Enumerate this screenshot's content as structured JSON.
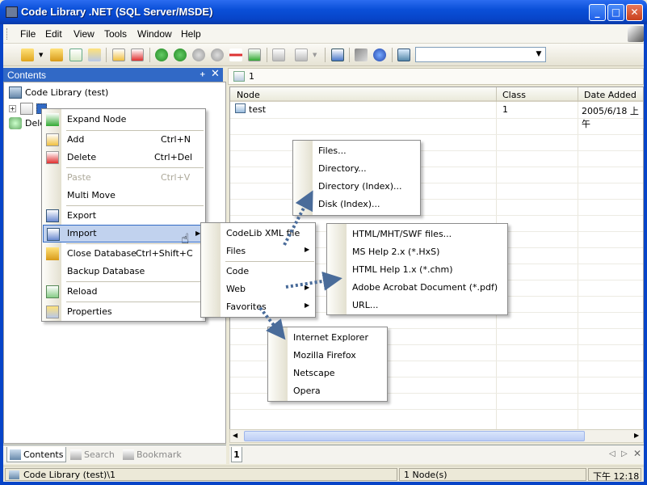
{
  "window": {
    "title": "Code Library .NET (SQL Server/MSDE)",
    "min": "_",
    "max": "□",
    "close": "✕"
  },
  "menubar": {
    "items": [
      "File",
      "Edit",
      "View",
      "Tools",
      "Window",
      "Help"
    ]
  },
  "contents_pane": {
    "title": "Contents",
    "pin": "ᚐ",
    "close": "✕"
  },
  "tree": {
    "root": "Code Library (test)",
    "deleted": "Dele"
  },
  "pane_tabs": [
    {
      "label": "Contents"
    },
    {
      "label": "Search"
    },
    {
      "label": "Bookmark"
    }
  ],
  "address": {
    "text": "1"
  },
  "grid": {
    "headers": [
      "Node",
      "Class",
      "Date Added"
    ],
    "rows": [
      {
        "node": "test",
        "class": "1",
        "date": "2005/6/18 上午"
      }
    ]
  },
  "grid_tab": "1",
  "grid_nav": {
    "prev": "◁",
    "next": "▷"
  },
  "status": {
    "path": "Code Library (test)\\1",
    "count": "1 Node(s)",
    "time": "下午 12:18"
  },
  "context_menu": {
    "items": [
      {
        "label": "Expand Node",
        "shortcut": ""
      },
      {
        "label": "Add",
        "shortcut": "Ctrl+N"
      },
      {
        "label": "Delete",
        "shortcut": "Ctrl+Del"
      },
      {
        "label": "Paste",
        "shortcut": "Ctrl+V"
      },
      {
        "label": "Multi Move",
        "shortcut": ""
      },
      {
        "label": "Export",
        "shortcut": ""
      },
      {
        "label": "Import",
        "shortcut": ""
      },
      {
        "label": "Close Database",
        "shortcut": "Ctrl+Shift+C"
      },
      {
        "label": "Backup Database",
        "shortcut": ""
      },
      {
        "label": "Reload",
        "shortcut": ""
      },
      {
        "label": "Properties",
        "shortcut": ""
      }
    ]
  },
  "import_menu": {
    "items": [
      "CodeLib XML file",
      "Files",
      "Code",
      "Web",
      "Favorites"
    ]
  },
  "files_menu": {
    "items": [
      "Files...",
      "Directory...",
      "Directory (Index)...",
      "Disk (Index)..."
    ]
  },
  "web_menu": {
    "items": [
      "HTML/MHT/SWF files...",
      "MS Help 2.x (*.HxS)",
      "HTML Help 1.x (*.chm)",
      "Adobe Acrobat Document (*.pdf)",
      "URL..."
    ]
  },
  "favorites_menu": {
    "items": [
      "Internet Explorer",
      "Mozilla Firefox",
      "Netscape",
      "Opera"
    ]
  },
  "colors": {
    "titlebar": "#0a4fd8",
    "highlight": "#c1d2ee",
    "pane_header": "#3169c6"
  }
}
